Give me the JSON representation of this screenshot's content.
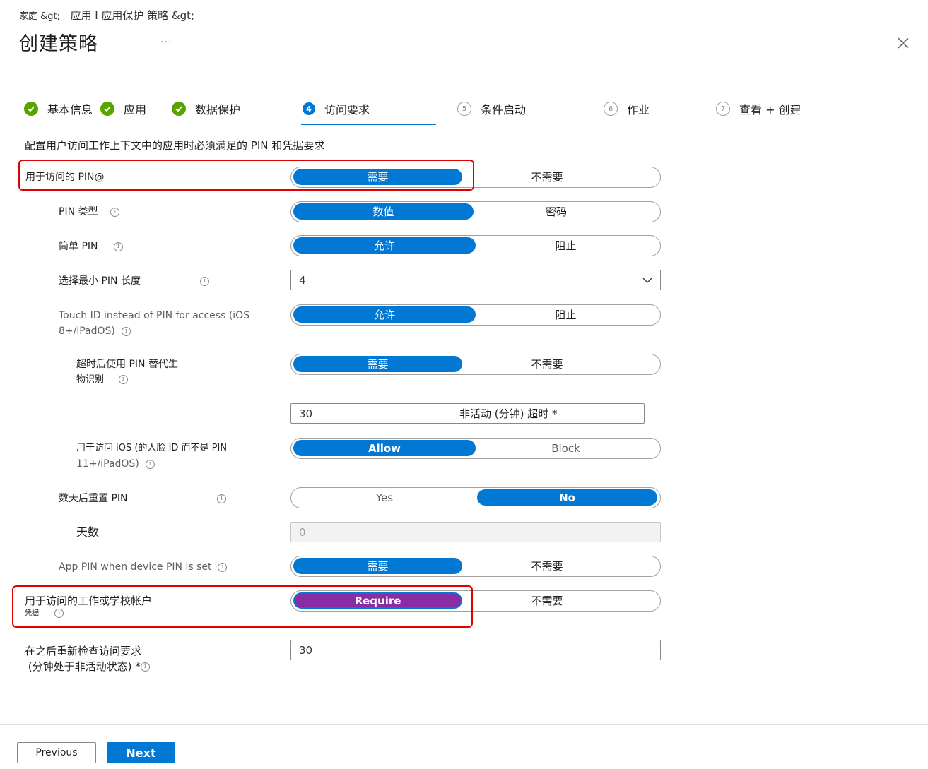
{
  "breadcrumb": {
    "part1": "家庭 &gt;",
    "part2": "应用 I 应用保护 策略 &gt;"
  },
  "header": {
    "title": "创建策略",
    "more": "...",
    "close_icon": "close-icon"
  },
  "steps": [
    {
      "number": "1",
      "label": "基本信息",
      "state": "done"
    },
    {
      "number": "2",
      "label": "应用",
      "state": "done"
    },
    {
      "number": "3",
      "label": "数据保护",
      "state": "done"
    },
    {
      "number": "4",
      "label": "访问要求",
      "state": "current"
    },
    {
      "number": "5",
      "label": "条件启动",
      "state": "todo"
    },
    {
      "number": "6",
      "label": "作业",
      "state": "todo"
    },
    {
      "number": "7",
      "label": "查看 + 创建",
      "state": "todo"
    }
  ],
  "description": "配置用户访问工作上下文中的应用时必须满足的 PIN 和凭据要求",
  "settings": {
    "pin_for_access": {
      "label": "用于访问的 PIN@",
      "options": [
        "需要",
        "不需要"
      ],
      "selected": "需要"
    },
    "pin_type": {
      "label": "PIN 类型",
      "options": [
        "数值",
        "密码"
      ],
      "selected": "数值"
    },
    "simple_pin": {
      "label": "简单 PIN",
      "options": [
        "允许",
        "阻止"
      ],
      "selected": "允许"
    },
    "min_pin_length": {
      "label": "选择最小 PIN 长度",
      "value": "4"
    },
    "touch_id": {
      "label_line1": "Touch ID instead of PIN for access (iOS",
      "label_line2": "8+/iPadOS)",
      "options": [
        "允许",
        "阻止"
      ],
      "selected": "允许"
    },
    "biometrics_timeout": {
      "label_line1": "超时后使用 PIN 替代生",
      "label_line2": "物识别",
      "options": [
        "需要",
        "不需要"
      ],
      "selected": "需要"
    },
    "timeout_minutes": {
      "value": "30",
      "inline_label": "非活动 (分钟) 超时 *"
    },
    "face_id": {
      "label_line1": "用于访问 iOS (的人脸 ID 而不是 PIN",
      "label_line2": "11+/iPadOS)",
      "options": [
        "Allow",
        "Block"
      ],
      "selected": "Allow"
    },
    "pin_reset_days": {
      "label": "数天后重置 PIN",
      "options": [
        "Yes",
        "No"
      ],
      "selected": "No"
    },
    "days": {
      "label": "天数",
      "value": "0"
    },
    "app_pin_device_pin": {
      "label": "App PIN when device PIN is set",
      "options": [
        "需要",
        "不需要"
      ],
      "selected": "需要"
    },
    "work_account_creds": {
      "label_line1": "用于访问的工作或学校帐户",
      "label_line2": "凭据",
      "options": [
        "Require",
        "不需要"
      ],
      "selected": "Require"
    },
    "recheck": {
      "label_line1": "在之后重新检查访问要求",
      "label_line2": "(分钟处于非活动状态) *",
      "value": "30"
    }
  },
  "footer": {
    "previous": "Previous",
    "next": "Next"
  },
  "colors": {
    "accent": "#0078d4",
    "done": "#57a300",
    "highlight": "#e00000",
    "purple": "#8a2da5"
  }
}
